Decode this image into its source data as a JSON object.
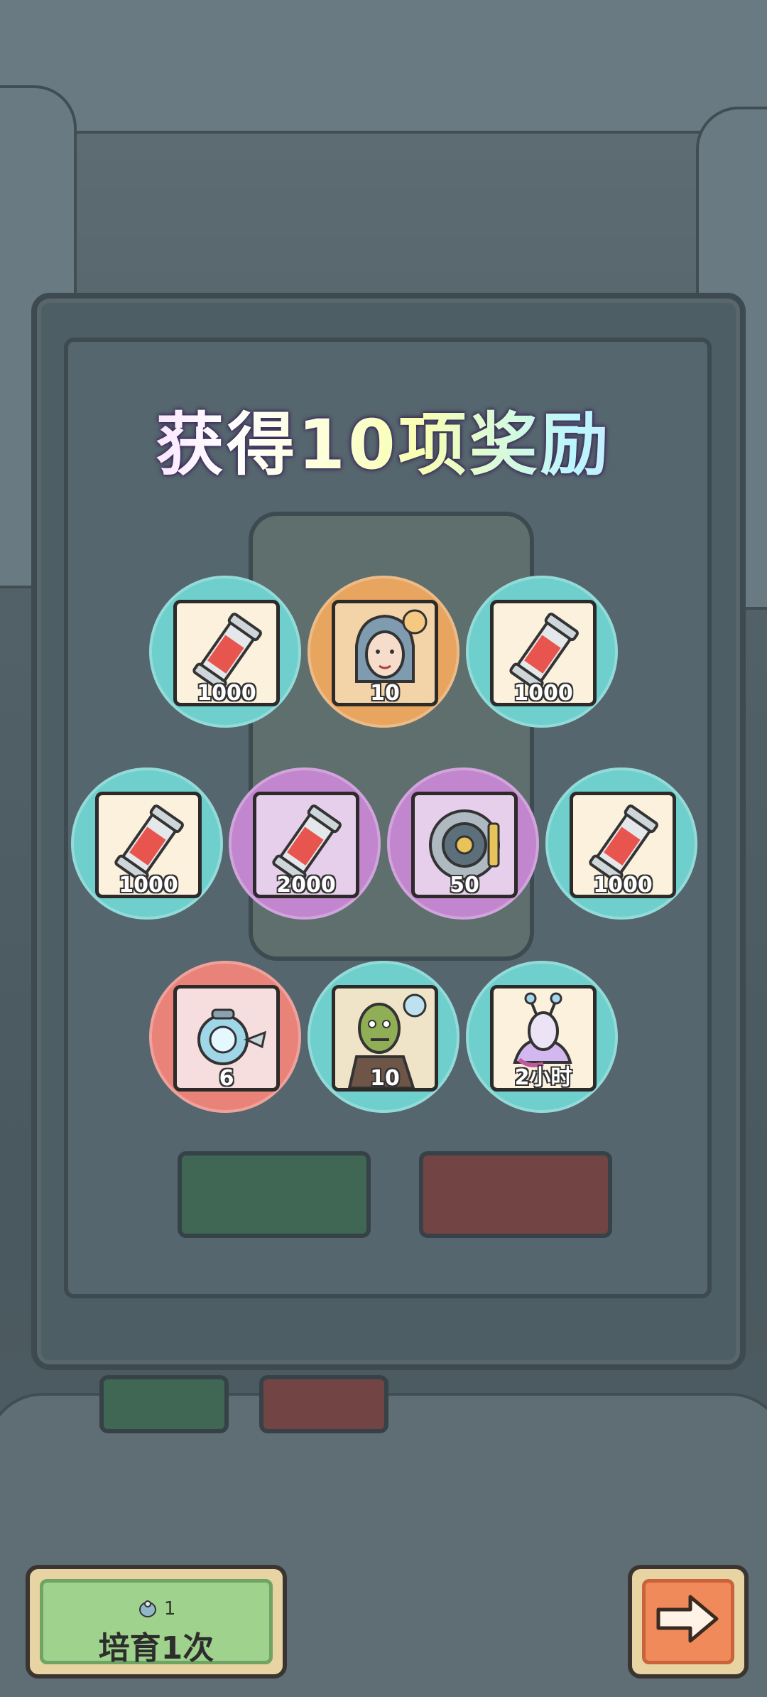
{
  "header": {
    "title": "获得10项奖励"
  },
  "rewards": [
    {
      "count": "1000",
      "item": "potion-tube-icon",
      "rarity": "teal"
    },
    {
      "count": "10",
      "item": "character-portrait-icon",
      "rarity": "orange"
    },
    {
      "count": "1000",
      "item": "potion-tube-icon",
      "rarity": "teal"
    },
    {
      "count": "1000",
      "item": "potion-tube-icon",
      "rarity": "teal"
    },
    {
      "count": "2000",
      "item": "potion-tube-icon",
      "rarity": "purple"
    },
    {
      "count": "50",
      "item": "gear-device-icon",
      "rarity": "purple"
    },
    {
      "count": "1000",
      "item": "potion-tube-icon",
      "rarity": "teal"
    },
    {
      "count": "6",
      "item": "orb-robot-icon",
      "rarity": "red"
    },
    {
      "count": "10",
      "item": "zombie-portrait-icon",
      "rarity": "teal"
    },
    {
      "count": "2小时",
      "item": "snail-creature-icon",
      "rarity": "teal"
    }
  ],
  "footer": {
    "breed_cost": "1",
    "breed_label": "培育1次",
    "next_icon": "arrow-right-icon"
  },
  "colors": {
    "teal": "#6fcfcc",
    "orange": "#e7a55f",
    "purple": "#c286cf",
    "red": "#e9837a",
    "breed_green": "#9fd28c",
    "next_orange": "#f08a5a"
  }
}
